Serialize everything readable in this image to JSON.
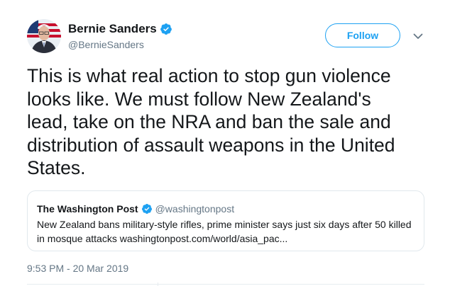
{
  "author": {
    "display_name": "Bernie Sanders",
    "handle": "@BernieSanders",
    "verified_icon": "verified-badge-icon"
  },
  "follow_button": {
    "label": "Follow"
  },
  "menu_icon": "chevron-down-icon",
  "tweet": {
    "text_lines": [
      "This is what real action to stop gun violence",
      "looks like. We must follow New Zealand's",
      "lead, take on the NRA and ban the sale and",
      "distribution of assault weapons in the United",
      "States."
    ],
    "timestamp": "9:53 PM - 20 Mar 2019"
  },
  "quoted_tweet": {
    "display_name": "The Washington Post",
    "handle": "@washingtonpost",
    "text_lines": [
      "New Zealand bans military-style rifles, prime minister says just six days after 50 killed",
      "in mosque attacks washingtonpost.com/world/asia_pac..."
    ]
  },
  "colors": {
    "brand_blue": "#1da1f2",
    "text_primary": "#14171a",
    "text_secondary": "#657786",
    "border": "#e1e8ed"
  }
}
